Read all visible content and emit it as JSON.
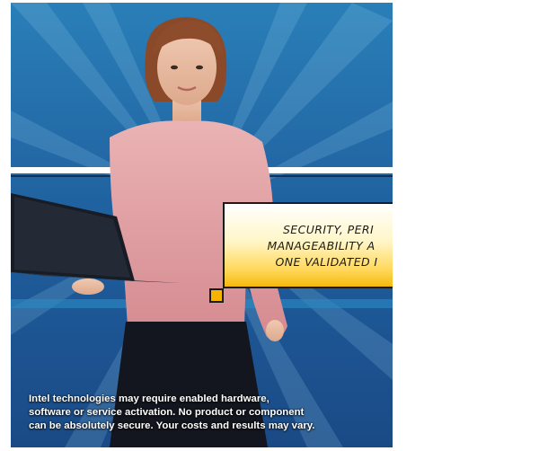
{
  "ad": {
    "caption_lines": [
      "SECURITY, PERI",
      "MANAGEABILITY A",
      "ONE VALIDATED I"
    ],
    "disclaimer_lines": [
      "Intel technologies may require enabled hardware,",
      "software or service activation. No product or component",
      "can be absolutely secure.  Your costs and results may vary."
    ]
  },
  "colors": {
    "background": "#1e5a96",
    "accent_yellow": "#f6b90d",
    "sweater": "#e8a2a6"
  }
}
